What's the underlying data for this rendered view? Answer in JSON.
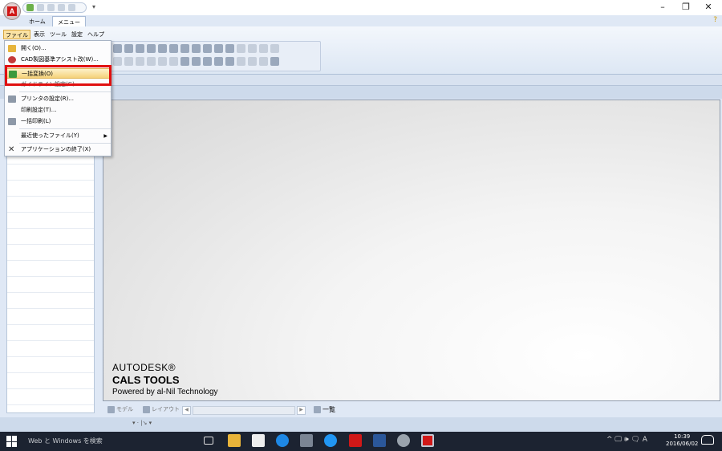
{
  "titlebar": {
    "controls": {
      "minimize": "–",
      "restore": "❐",
      "close": "✕"
    },
    "qat_more": "▾"
  },
  "ribbon_tabs": [
    "ホーム",
    "メニュー"
  ],
  "help_icon": "?",
  "menubar": [
    "ファイル",
    "表示",
    "ツール",
    "設定",
    "ヘルプ"
  ],
  "file_menu": {
    "items": [
      {
        "label": "開く(O)...",
        "icon": "open-folder-icon"
      },
      {
        "label": "CAD製図基準アシスト改(W)...",
        "icon": "cad-assist-icon"
      },
      {
        "label": "一括変換(O)",
        "icon": "batch-convert-icon",
        "highlighted": true
      },
      {
        "label": "ガイドライン設定(G)...",
        "icon": ""
      },
      {
        "label": "プリンタの設定(R)...",
        "icon": "printer-icon"
      },
      {
        "label": "印刷設定(T)...",
        "icon": ""
      },
      {
        "label": "一括印刷(L)",
        "icon": "batch-print-icon"
      },
      {
        "label": "最近使ったファイル(Y)",
        "icon": "",
        "submenu": true
      },
      {
        "label": "アプリケーションの終了(X)",
        "icon": "close-icon"
      }
    ]
  },
  "brand": {
    "line1": "AUTODESK®",
    "line2": "CALS TOOLS",
    "line3": "Powered by al-Nil Technology"
  },
  "bottom": {
    "model_tab": "モデル",
    "layout_tab": "レイアウト",
    "list_label": "一覧",
    "scroll_left": "◀",
    "scroll_right": "▶"
  },
  "statusbar_mini": "▾ ⋅ |↘ ▾",
  "taskbar": {
    "search_placeholder": "Web と Windows を検索",
    "tray_icons": "^ 🖵 🕪 🗨 A",
    "time": "10:39",
    "date": "2016/06/02"
  },
  "colors": {
    "accent_red": "#e01010",
    "menu_highlight": "#f5d27a",
    "taskbar": "#1c2331"
  }
}
